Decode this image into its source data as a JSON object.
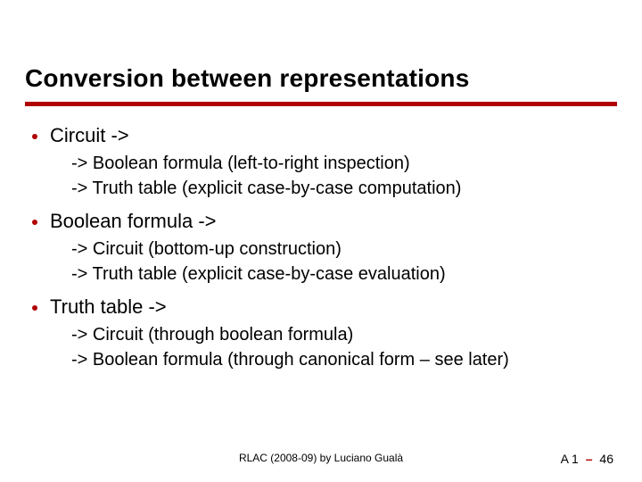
{
  "title": "Conversion between representations",
  "bullets": [
    {
      "heading": "Circuit ->",
      "subs": [
        "-> Boolean formula (left-to-right inspection)",
        "-> Truth table (explicit case-by-case computation)"
      ]
    },
    {
      "heading": "Boolean formula ->",
      "subs": [
        "-> Circuit (bottom-up construction)",
        "-> Truth table (explicit case-by-case evaluation)"
      ]
    },
    {
      "heading": "Truth table ->",
      "subs": [
        "-> Circuit (through boolean formula)",
        "-> Boolean formula (through canonical form – see later)"
      ]
    }
  ],
  "footer": {
    "center": "RLAC (2008-09) by Luciano Gualà",
    "right_prefix": "A 1",
    "right_dash": "–",
    "right_page": "46"
  },
  "colors": {
    "accent": "#b00000"
  }
}
